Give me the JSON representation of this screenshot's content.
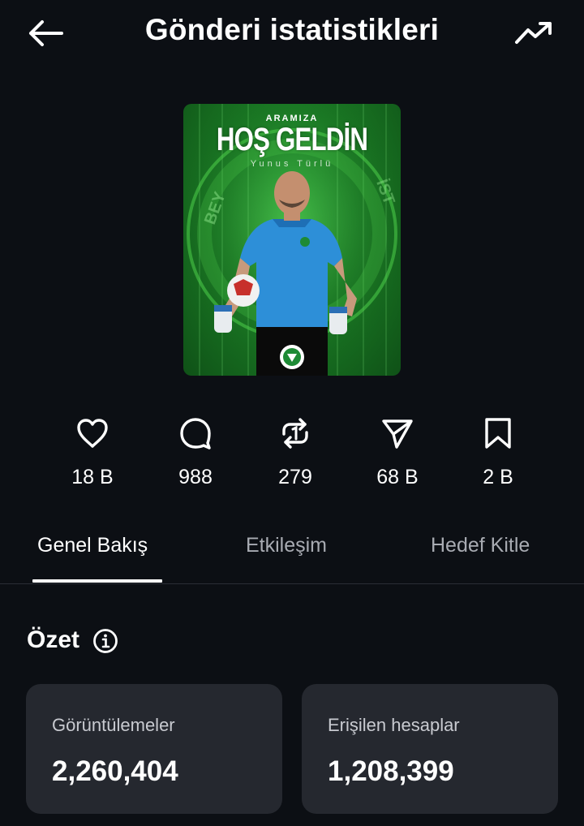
{
  "header": {
    "title": "Gönderi istatistikleri",
    "back_icon": "arrow-left-icon",
    "trend_icon": "trending-up-icon"
  },
  "post_image": {
    "small_text": "ARAMIZA",
    "headline": "HOŞ GELDİN",
    "name": "Yunus Türlü",
    "side_text_left": "BEY",
    "side_text_right": "İST"
  },
  "stats": [
    {
      "icon": "heart-icon",
      "value": "18 B"
    },
    {
      "icon": "comment-icon",
      "value": "988"
    },
    {
      "icon": "repost-icon",
      "value": "279"
    },
    {
      "icon": "share-icon",
      "value": "68 B"
    },
    {
      "icon": "bookmark-icon",
      "value": "2 B"
    }
  ],
  "tabs": [
    {
      "label": "Genel Bakış",
      "active": true
    },
    {
      "label": "Etkileşim",
      "active": false
    },
    {
      "label": "Hedef Kitle",
      "active": false
    }
  ],
  "summary": {
    "title": "Özet",
    "info_icon": "info-icon",
    "cards": [
      {
        "label": "Görüntülemeler",
        "value": "2,260,404"
      },
      {
        "label": "Erişilen hesaplar",
        "value": "1,208,399"
      }
    ]
  },
  "colors": {
    "background": "#0c0f14",
    "card": "#25282f",
    "accent_green": "#2ea93a",
    "text_muted": "#a8abb2"
  }
}
